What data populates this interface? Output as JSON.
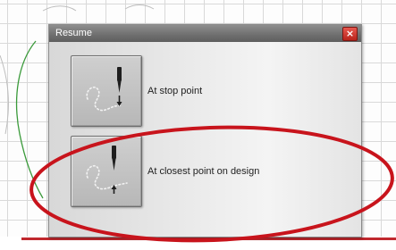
{
  "dialog": {
    "title": "Resume",
    "close_glyph": "×",
    "options": [
      {
        "label": "At stop point",
        "icon": "needle-stop-point-icon"
      },
      {
        "label": "At closest point on design",
        "icon": "needle-closest-point-icon"
      }
    ]
  },
  "colors": {
    "annotation_ellipse": "#c8141c",
    "close_button": "#d2372e",
    "hoop_curve": "#3a9a3a",
    "bottom_line": "#c0282e"
  },
  "icons": [
    "close-icon",
    "needle-stop-point-icon",
    "needle-closest-point-icon"
  ]
}
